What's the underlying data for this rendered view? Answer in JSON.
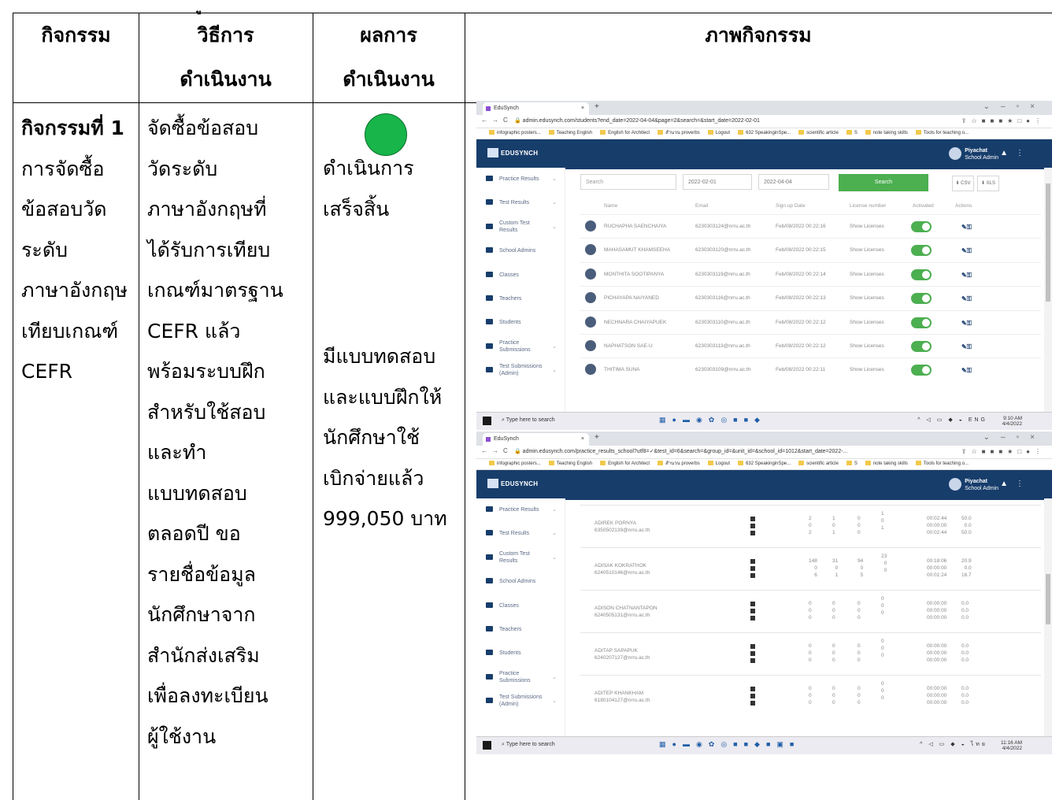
{
  "header": {
    "top_fragment": "ู",
    "col_activity": "กิจกรรม",
    "col_method": [
      "วิธีการ",
      "ดำเนินงาน"
    ],
    "col_result": [
      "ผลการ",
      "ดำเนินงาน"
    ],
    "col_image": "ภาพกิจกรรม"
  },
  "row": {
    "activity_title": "กิจกรรมที่ 1",
    "activity_lines": [
      "การจัดซื้อ",
      "ข้อสอบวัด",
      "ระดับ",
      "ภาษาอังกฤษ",
      "เทียบเกณฑ์",
      "CEFR"
    ],
    "method_lines": [
      "จัดซื้อข้อสอบ",
      "วัดระดับ",
      "ภาษาอังกฤษที่",
      "ได้รับการเทียบ",
      "เกณฑ์มาตรฐาน",
      "CEFR แล้ว",
      "พร้อมระบบฝึก",
      "สำหรับใช้สอบ",
      "และทำ",
      "แบบทดสอบ",
      "ตลอดปี ขอ",
      "รายชื่อข้อมูล",
      "นักศึกษาจาก",
      "สำนักส่งเสริม",
      "เพื่อลงทะเบียน",
      "ผู้ใช้งาน"
    ],
    "result_a": [
      "ดำเนินการ",
      "เสร็จสิ้น"
    ],
    "result_b": [
      "มีแบบทดสอบ",
      "และแบบฝึกให้",
      "นักศึกษาใช้",
      "เบิกจ่ายแล้ว",
      "999,050 บาท"
    ],
    "status_color": "#18b54a"
  },
  "browser": {
    "tab_title": "EduSynch",
    "url1": "admin.edusynch.com/students?end_date=2022-04-04&page=2&search=&start_date=2022-02-01",
    "url2": "admin.edusynch.com/practice_results_school?utf8=✓&test_id=6&search=&group_id=&unit_id=&school_id=1012&start_date=2022-...",
    "bookmarks": [
      "infographic posters...",
      "Teaching English",
      "English for Architect",
      "สำนวน proverbs",
      "Logout",
      "632 SpeakinginSpe...",
      "scientific article",
      "S",
      "note taking skills",
      "Tools for teaching o..."
    ]
  },
  "app": {
    "logo": "EDUSYNCH",
    "user_name": "Piyachat",
    "user_role": "School Admin",
    "brand_color": "#173d6b",
    "accent_green": "#4caf50"
  },
  "sidebar": [
    {
      "label": "Practice Results",
      "dd": true
    },
    {
      "label": "Test Results",
      "dd": true
    },
    {
      "label": "Custom Test Results",
      "dd": true
    },
    {
      "label": "School Admins",
      "dd": false
    },
    {
      "label": "Classes",
      "dd": false
    },
    {
      "label": "Teachers",
      "dd": false
    },
    {
      "label": "Students",
      "dd": false
    },
    {
      "label": "Practice Submissions",
      "dd": true
    },
    {
      "label": "Test Submissions (Admin)",
      "dd": true
    }
  ],
  "students": {
    "search_placeholder": "Search",
    "start_date": "2022-02-01",
    "end_date": "2022-04-04",
    "search_button": "Search",
    "csv": "CSV",
    "xls": "XLS",
    "columns": [
      "Name",
      "Email",
      "Sign up Date",
      "License number",
      "Activated",
      "Actions"
    ],
    "rows": [
      {
        "name": "RUCHAPHA SAENCHAIYA",
        "email": "6230303124@nrru.ac.th",
        "date": "Feb/08/2022 00:22:16",
        "license": "Show Licenses"
      },
      {
        "name": "MAHASAMUT KHAMSEEHA",
        "email": "6230303120@nrru.ac.th",
        "date": "Feb/08/2022 00:22:15",
        "license": "Show Licenses"
      },
      {
        "name": "MONTHITA SOOTIPANYA",
        "email": "6230303119@nrru.ac.th",
        "date": "Feb/08/2022 00:22:14",
        "license": "Show Licenses"
      },
      {
        "name": "PICHAYAPA NAIYANED",
        "email": "6230303116@nrru.ac.th",
        "date": "Feb/08/2022 00:22:13",
        "license": "Show Licenses"
      },
      {
        "name": "NECHNARA CHAIYAPUEK",
        "email": "6230303110@nrru.ac.th",
        "date": "Feb/08/2022 00:22:12",
        "license": "Show Licenses"
      },
      {
        "name": "NAPHATSON SAE-U",
        "email": "6230303113@nrru.ac.th",
        "date": "Feb/08/2022 00:22:12",
        "license": "Show Licenses"
      },
      {
        "name": "THITIMA SUNA",
        "email": "6230303109@nrru.ac.th",
        "date": "Feb/08/2022 00:22:11",
        "license": "Show Licenses"
      }
    ]
  },
  "practice": {
    "rows": [
      {
        "name": "ADIREK PORNYA",
        "email": "6350502139@nrru.ac.th",
        "c1": [
          "2",
          "0",
          "2"
        ],
        "c2": [
          "1",
          "0",
          "1"
        ],
        "c3": [
          "0",
          "0",
          "0"
        ],
        "c4": [
          "1",
          "0",
          "1"
        ],
        "time": [
          "00:02:44",
          "00:00:00",
          "00:02:44"
        ],
        "score": [
          "50.0",
          "0.0",
          "50.0"
        ]
      },
      {
        "name": "ADISAK KOKRATHOK",
        "email": "6240510146@nrru.ac.th",
        "c1": [
          "148",
          "0",
          "6"
        ],
        "c2": [
          "31",
          "0",
          "1"
        ],
        "c3": [
          "94",
          "0",
          "5"
        ],
        "c4": [
          "23",
          "0",
          "0"
        ],
        "time": [
          "00:18:06",
          "00:00:00",
          "00:01:24"
        ],
        "score": [
          "20.9",
          "0.0",
          "16.7"
        ]
      },
      {
        "name": "ADISON CHATNANTAPON",
        "email": "6240505131@nrru.ac.th",
        "c1": [
          "0",
          "0",
          "0"
        ],
        "c2": [
          "0",
          "0",
          "0"
        ],
        "c3": [
          "0",
          "0",
          "0"
        ],
        "c4": [
          "0",
          "0",
          "0"
        ],
        "time": [
          "00:00:00",
          "00:00:00",
          "00:00:00"
        ],
        "score": [
          "0.0",
          "0.0",
          "0.0"
        ]
      },
      {
        "name": "ADITAP SAPAPUK",
        "email": "6240207127@nrru.ac.th",
        "c1": [
          "0",
          "0",
          "0"
        ],
        "c2": [
          "0",
          "0",
          "0"
        ],
        "c3": [
          "0",
          "0",
          "0"
        ],
        "c4": [
          "0",
          "0",
          "0"
        ],
        "time": [
          "00:00:00",
          "00:00:00",
          "00:00:00"
        ],
        "score": [
          "0.0",
          "0.0",
          "0.0"
        ]
      },
      {
        "name": "ADITEP KHANKHAM",
        "email": "6180104127@nrru.ac.th",
        "c1": [
          "0",
          "0",
          "0"
        ],
        "c2": [
          "0",
          "0",
          "0"
        ],
        "c3": [
          "0",
          "0",
          "0"
        ],
        "c4": [
          "0",
          "0",
          "0"
        ],
        "time": [
          "00:00:00",
          "00:00:00",
          "00:00:00"
        ],
        "score": [
          "0.0",
          "0.0",
          "0.0"
        ]
      }
    ]
  },
  "taskbar": {
    "search": "Type here to search",
    "lang": "ENG",
    "lang2": "ไทย",
    "time1": "9:10 AM",
    "date1": "4/4/2022",
    "time2": "11:16 AM",
    "date2": "4/4/2022"
  }
}
